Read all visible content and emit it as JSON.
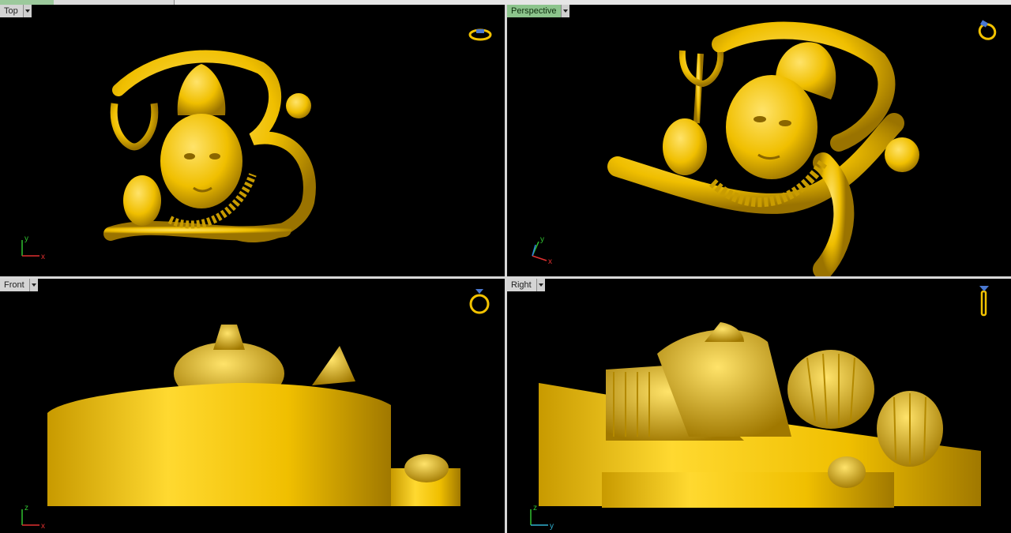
{
  "viewports": {
    "top": {
      "label": "Top",
      "axes": [
        "y",
        "x"
      ],
      "active": false
    },
    "perspective": {
      "label": "Perspective",
      "axes": [
        "y",
        "x"
      ],
      "active": true
    },
    "front": {
      "label": "Front",
      "axes": [
        "z",
        "x"
      ],
      "active": false
    },
    "right": {
      "label": "Right",
      "axes": [
        "z",
        "y"
      ],
      "active": false
    }
  },
  "colors": {
    "model": "#f2c200",
    "background": "#000000",
    "x_axis": "#e03030",
    "y_axis": "#30c030",
    "z_axis": "#30c030",
    "right_y_axis": "#30b0d0",
    "active_label": "#8cc48c"
  },
  "icons": {
    "top_view": "ring-top-icon",
    "perspective_view": "ring-perspective-icon",
    "front_view": "ring-front-icon",
    "right_view": "ring-side-icon"
  }
}
